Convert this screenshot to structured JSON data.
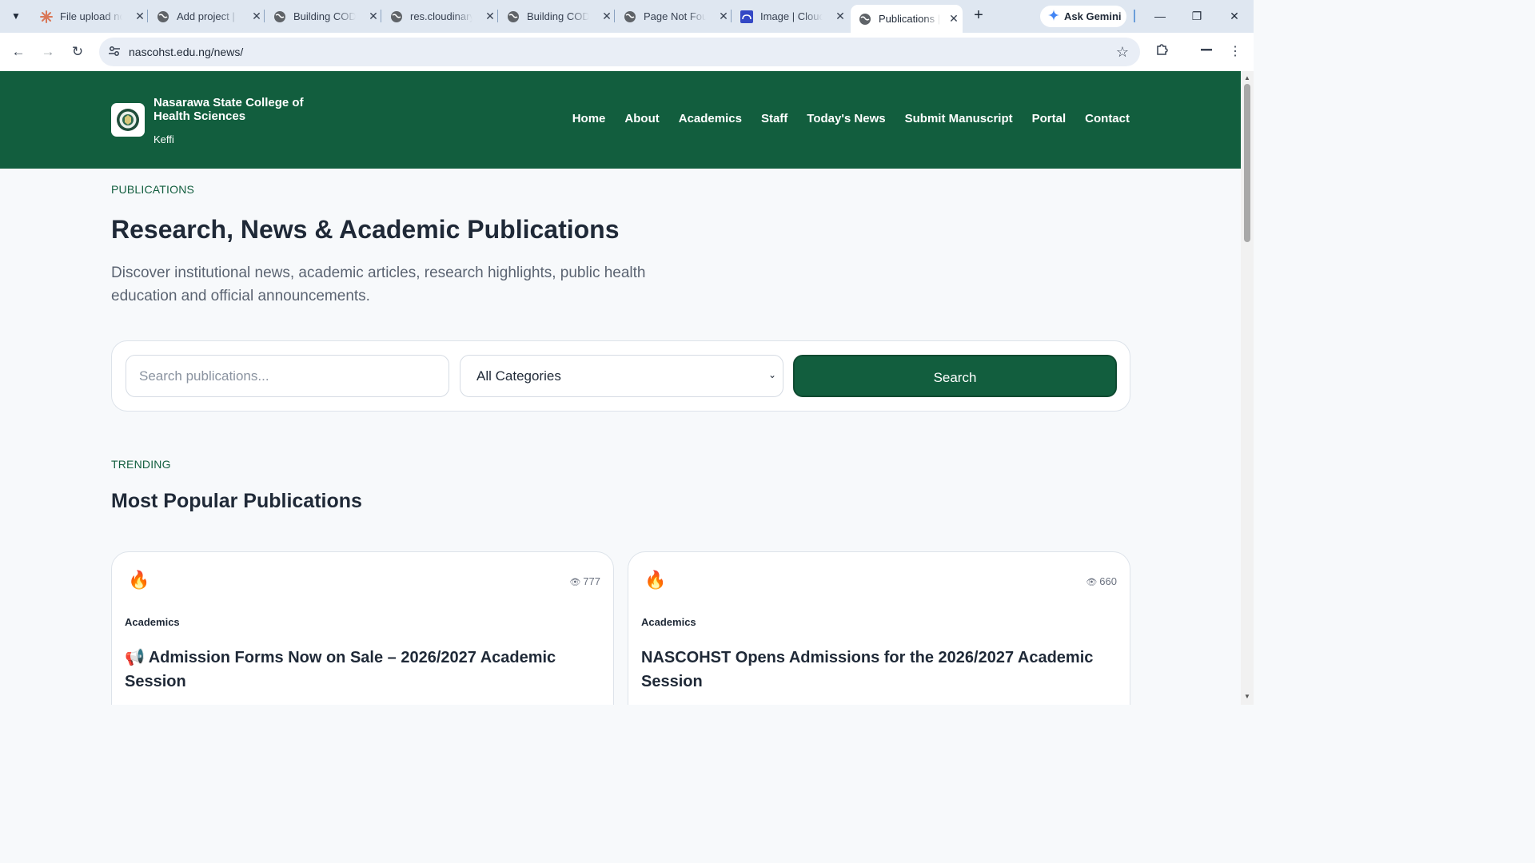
{
  "browser": {
    "tabs": [
      {
        "title": "File upload no",
        "icon": "claude-icon"
      },
      {
        "title": "Add project |",
        "icon": "globe-icon"
      },
      {
        "title": "Building COD",
        "icon": "globe-icon"
      },
      {
        "title": "res.cloudinary",
        "icon": "globe-icon"
      },
      {
        "title": "Building COD",
        "icon": "globe-icon"
      },
      {
        "title": "Page Not Fou",
        "icon": "globe-icon"
      },
      {
        "title": "Image | Clouc",
        "icon": "cloudinary-icon"
      },
      {
        "title": "Publications |",
        "icon": "globe-icon",
        "active": true
      }
    ],
    "ask_gemini": "Ask Gemini",
    "url": "nascohst.edu.ng/news/"
  },
  "site": {
    "name": "Nasarawa State College of Health Sciences",
    "location": "Keffi",
    "nav": [
      "Home",
      "About",
      "Academics",
      "Staff",
      "Today's News",
      "Submit Manuscript",
      "Portal",
      "Contact"
    ],
    "brand_color": "#125e3e"
  },
  "hero": {
    "eyebrow": "PUBLICATIONS",
    "title": "Research, News & Academic Publications",
    "description": "Discover institutional news, academic articles, research highlights, public health education and official announcements."
  },
  "search": {
    "placeholder": "Search publications...",
    "category_selected": "All Categories",
    "button_label": "Search"
  },
  "trending": {
    "eyebrow": "TRENDING",
    "title": "Most Popular Publications",
    "cards": [
      {
        "views": "777",
        "category": "Academics",
        "title": "📢 Admission Forms Now on Sale – 2026/2027 Academic Session"
      },
      {
        "views": "660",
        "category": "Academics",
        "title": "NASCOHST Opens Admissions for the 2026/2027 Academic Session"
      }
    ]
  }
}
